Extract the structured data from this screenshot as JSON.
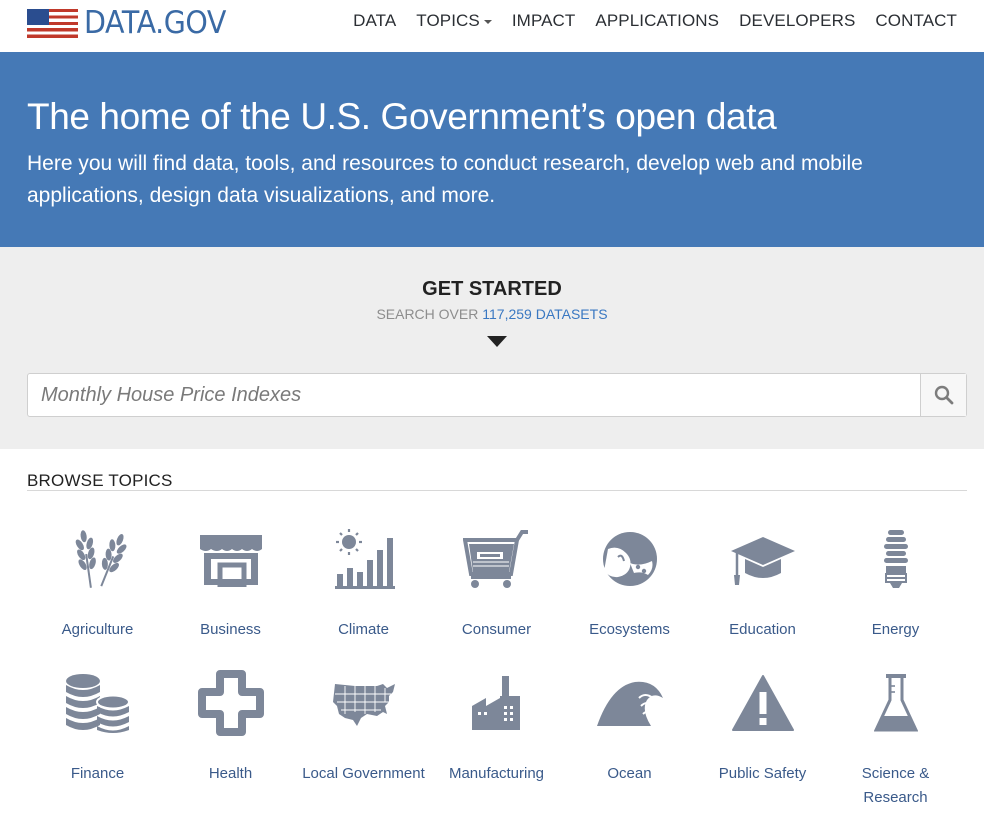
{
  "header": {
    "logo_text": "DATA.GOV",
    "nav": [
      {
        "label": "DATA"
      },
      {
        "label": "TOPICS"
      },
      {
        "label": "IMPACT"
      },
      {
        "label": "APPLICATIONS"
      },
      {
        "label": "DEVELOPERS"
      },
      {
        "label": "CONTACT"
      }
    ]
  },
  "hero": {
    "title": "The home of the U.S. Government’s open data",
    "subtitle": "Here you will find data, tools, and resources to conduct research, develop web and mobile applications, design data visualizations, and more."
  },
  "get_started": {
    "title": "GET STARTED",
    "sub_prefix": "SEARCH OVER ",
    "dataset_count": "117,259 DATASETS",
    "search_placeholder": "Monthly House Price Indexes",
    "search_icon": "search-icon"
  },
  "browse": {
    "title": "BROWSE TOPICS",
    "topics": [
      {
        "label": "Agriculture",
        "icon": "wheat-icon"
      },
      {
        "label": "Business",
        "icon": "storefront-icon"
      },
      {
        "label": "Climate",
        "icon": "sun-bar-chart-icon"
      },
      {
        "label": "Consumer",
        "icon": "shopping-cart-icon"
      },
      {
        "label": "Ecosystems",
        "icon": "ecosystem-globe-icon"
      },
      {
        "label": "Education",
        "icon": "graduation-cap-icon"
      },
      {
        "label": "Energy",
        "icon": "lightbulb-icon"
      },
      {
        "label": "Finance",
        "icon": "coin-stack-icon"
      },
      {
        "label": "Health",
        "icon": "medical-cross-icon"
      },
      {
        "label": "Local Government",
        "icon": "us-map-icon"
      },
      {
        "label": "Manufacturing",
        "icon": "factory-icon"
      },
      {
        "label": "Ocean",
        "icon": "wave-icon"
      },
      {
        "label": "Public Safety",
        "icon": "warning-icon"
      },
      {
        "label": "Science & Research",
        "icon": "flask-icon"
      }
    ]
  },
  "colors": {
    "hero_bg": "#4579b6",
    "icon_gray": "#7d8799",
    "link_blue": "#3a78c2"
  }
}
